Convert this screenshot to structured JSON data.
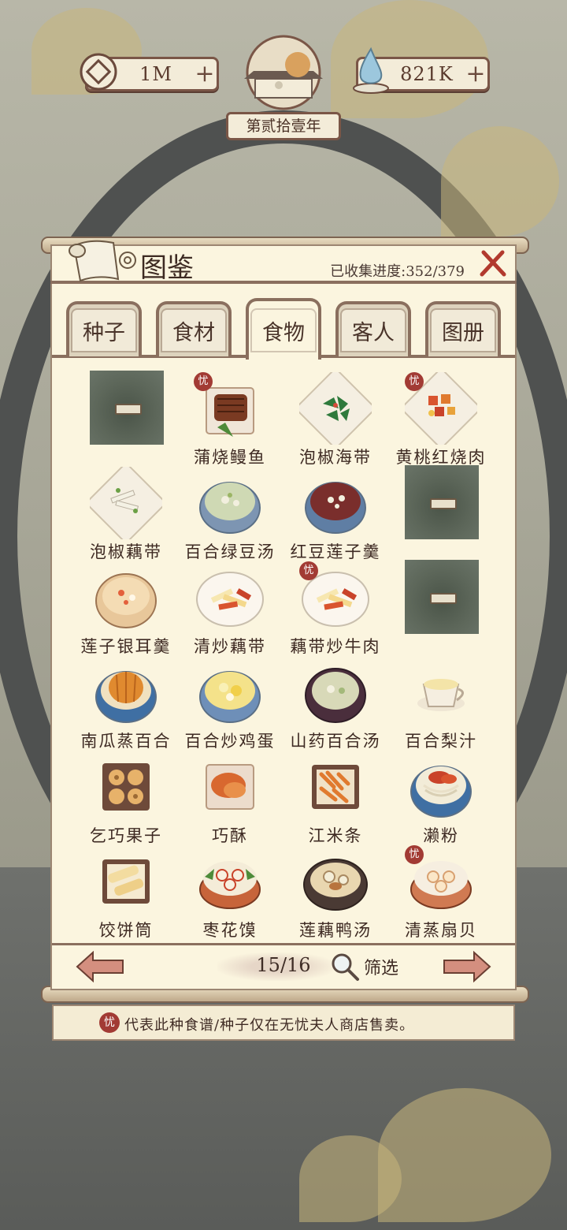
{
  "hud": {
    "coins": "1M",
    "water": "821K",
    "plus": "+",
    "year": "第贰拾壹年"
  },
  "codex": {
    "title": "图鉴",
    "progress": "已收集进度:352/379",
    "tabs": [
      {
        "label": "种子",
        "active": false
      },
      {
        "label": "食材",
        "active": false
      },
      {
        "label": "食物",
        "active": true
      },
      {
        "label": "客人",
        "active": false
      },
      {
        "label": "图册",
        "active": false
      }
    ],
    "items": [
      {
        "name": "",
        "locked": true,
        "exclusive": false
      },
      {
        "name": "蒲烧鳗鱼",
        "locked": false,
        "exclusive": true,
        "dish": "eel"
      },
      {
        "name": "泡椒海带",
        "locked": false,
        "exclusive": false,
        "dish": "greens"
      },
      {
        "name": "黄桃红烧肉",
        "locked": false,
        "exclusive": true,
        "dish": "redpork"
      },
      {
        "name": "泡椒藕带",
        "locked": false,
        "exclusive": false,
        "dish": "whiteplate"
      },
      {
        "name": "百合绿豆汤",
        "locked": false,
        "exclusive": false,
        "dish": "greensoup"
      },
      {
        "name": "红豆莲子羹",
        "locked": false,
        "exclusive": false,
        "dish": "redsoup"
      },
      {
        "name": "",
        "locked": true,
        "exclusive": false
      },
      {
        "name": "莲子银耳羹",
        "locked": false,
        "exclusive": false,
        "dish": "lotusbowl"
      },
      {
        "name": "清炒藕带",
        "locked": false,
        "exclusive": false,
        "dish": "stirfry"
      },
      {
        "name": "藕带炒牛肉",
        "locked": false,
        "exclusive": true,
        "dish": "stirfry"
      },
      {
        "name": "",
        "locked": true,
        "exclusive": false
      },
      {
        "name": "南瓜蒸百合",
        "locked": false,
        "exclusive": false,
        "dish": "pumpkin"
      },
      {
        "name": "百合炒鸡蛋",
        "locked": false,
        "exclusive": false,
        "dish": "egg"
      },
      {
        "name": "山药百合汤",
        "locked": false,
        "exclusive": false,
        "dish": "darksoup"
      },
      {
        "name": "百合梨汁",
        "locked": false,
        "exclusive": false,
        "dish": "cup"
      },
      {
        "name": "乞巧果子",
        "locked": false,
        "exclusive": false,
        "dish": "cookies"
      },
      {
        "name": "巧酥",
        "locked": false,
        "exclusive": false,
        "dish": "pastry"
      },
      {
        "name": "江米条",
        "locked": false,
        "exclusive": false,
        "dish": "sticks"
      },
      {
        "name": "濑粉",
        "locked": false,
        "exclusive": false,
        "dish": "noodles"
      },
      {
        "name": "饺饼筒",
        "locked": false,
        "exclusive": false,
        "dish": "rolls"
      },
      {
        "name": "枣花馍",
        "locked": false,
        "exclusive": false,
        "dish": "steamer"
      },
      {
        "name": "莲藕鸭汤",
        "locked": false,
        "exclusive": false,
        "dish": "duckpot"
      },
      {
        "name": "清蒸扇贝",
        "locked": false,
        "exclusive": true,
        "dish": "scallop"
      }
    ],
    "badge_char": "忧",
    "pagination": "15/16",
    "filter_label": "筛选",
    "notice": "代表此种食谱/种子仅在无忧夫人商店售卖。"
  },
  "colors": {
    "frame": "#8a6f5e",
    "parchment": "#fbf5df",
    "badge_red": "#a23b34",
    "arrow": "#d48f7f"
  }
}
